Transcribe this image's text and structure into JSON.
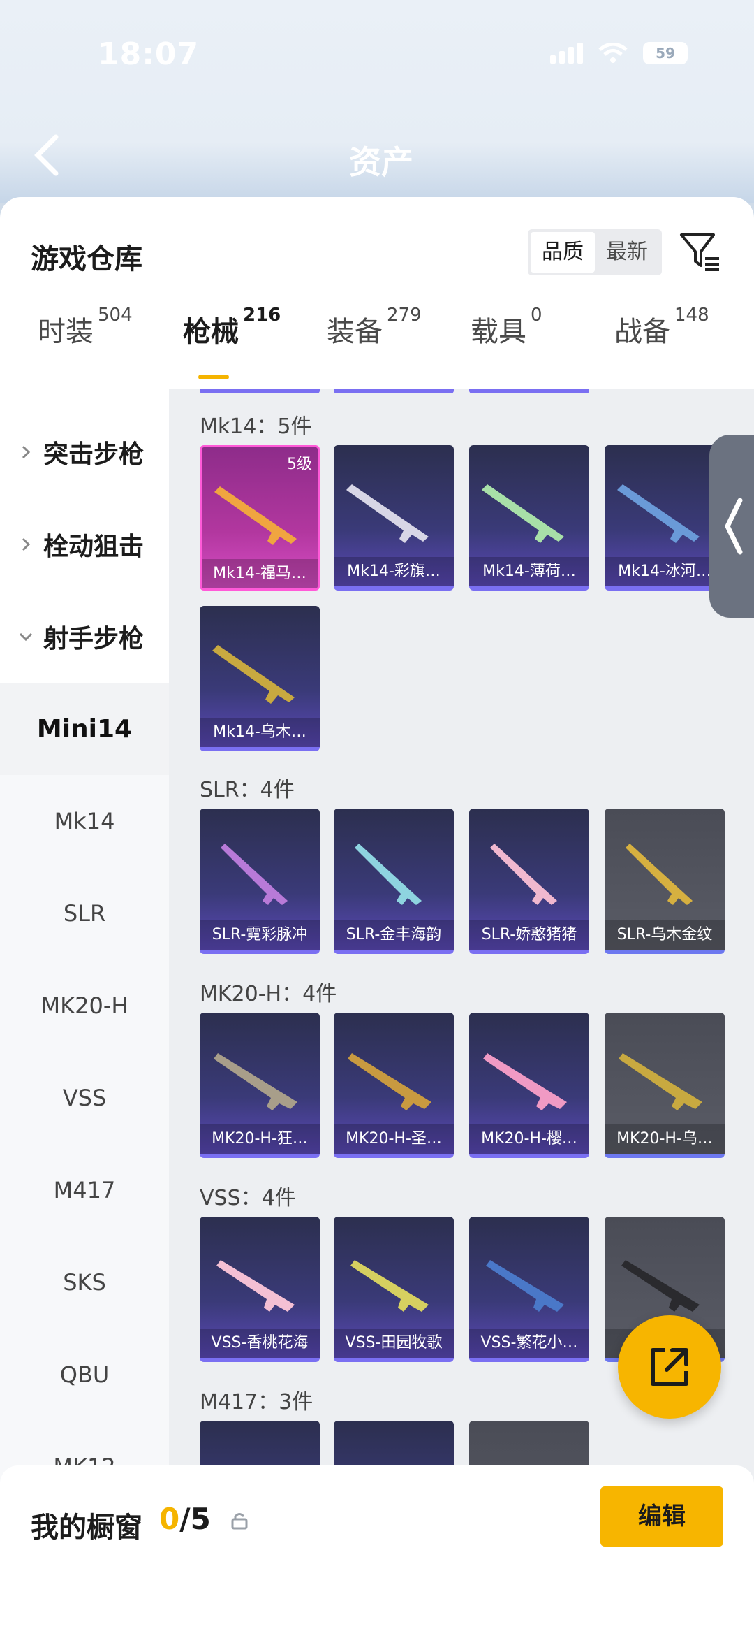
{
  "status_bar": {
    "time": "18:07",
    "battery": "59"
  },
  "header": {
    "title": "资产"
  },
  "sheet": {
    "title": "游戏仓库",
    "sort_options": [
      "品质",
      "最新"
    ],
    "active_sort": "品质"
  },
  "tabs": [
    {
      "label": "时装",
      "count": "504"
    },
    {
      "label": "枪械",
      "count": "216"
    },
    {
      "label": "装备",
      "count": "279"
    },
    {
      "label": "载具",
      "count": "0"
    },
    {
      "label": "战备",
      "count": "148"
    }
  ],
  "sidebar": {
    "groups": [
      "突击步枪",
      "栓动狙击",
      "射手步枪"
    ],
    "items": [
      "Mini14",
      "Mk14",
      "SLR",
      "MK20-H",
      "VSS",
      "M417",
      "SKS",
      "QBU",
      "MK12"
    ]
  },
  "sections": [
    {
      "title": "Mk14：5件",
      "cards": [
        "Mk14-福马…",
        "Mk14-彩旗…",
        "Mk14-薄荷…",
        "Mk14-冰河…",
        "Mk14-乌木…"
      ],
      "first_level": "5级"
    },
    {
      "title": "SLR：4件",
      "cards": [
        "SLR-霓彩脉冲",
        "SLR-金丰海韵",
        "SLR-娇憨猪猪",
        "SLR-乌木金纹"
      ]
    },
    {
      "title": "MK20-H：4件",
      "cards": [
        "MK20-H-狂…",
        "MK20-H-圣…",
        "MK20-H-樱…",
        "MK20-H-乌…"
      ]
    },
    {
      "title": "VSS：4件",
      "cards": [
        "VSS-香桃花海",
        "VSS-田园牧歌",
        "VSS-繁花小…",
        "V"
      ]
    },
    {
      "title": "M417：3件",
      "cards": []
    }
  ],
  "bottom": {
    "label": "我的橱窗",
    "current": "0",
    "total": "/5",
    "edit_label": "编辑"
  },
  "colors": {
    "accent": "#f7b500",
    "purple_card": "#3a3a78",
    "gold_card": "#b2379f",
    "gray_card": "#5a5c66"
  },
  "icons": [
    "back-arrow-icon",
    "filter-icon",
    "chevron-right-icon",
    "chevron-down-icon",
    "lock-icon",
    "share-icon",
    "panel-expand-icon"
  ]
}
